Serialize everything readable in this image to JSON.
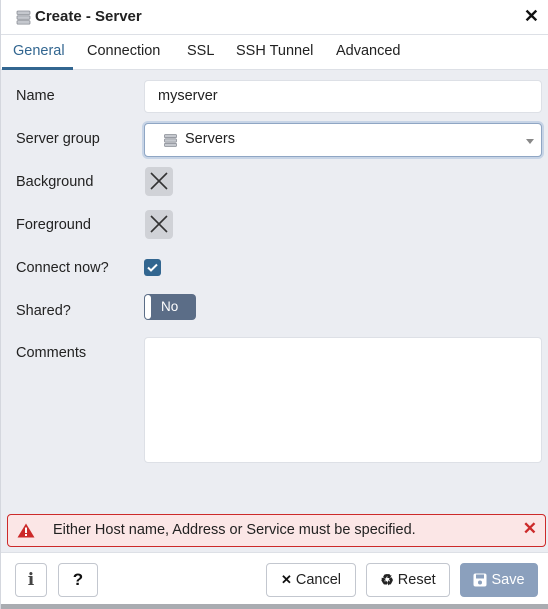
{
  "dialog": {
    "title": "Create - Server",
    "title_icon": "server-icon",
    "close_label": "✕"
  },
  "tabs": [
    {
      "label": "General",
      "active": true
    },
    {
      "label": "Connection",
      "active": false
    },
    {
      "label": "SSL",
      "active": false
    },
    {
      "label": "SSH Tunnel",
      "active": false
    },
    {
      "label": "Advanced",
      "active": false
    }
  ],
  "form": {
    "name": {
      "label": "Name",
      "value": "myserver"
    },
    "server_group": {
      "label": "Server group",
      "value": "Servers",
      "icon": "server-group-icon"
    },
    "background": {
      "label": "Background",
      "icon": "x-icon"
    },
    "foreground": {
      "label": "Foreground",
      "icon": "x-icon"
    },
    "connect_now": {
      "label": "Connect now?",
      "checked": true
    },
    "shared": {
      "label": "Shared?",
      "value": "No"
    },
    "comments": {
      "label": "Comments",
      "value": ""
    }
  },
  "alert": {
    "message": "Either Host name, Address or Service must be specified.",
    "icon": "warning-triangle-icon",
    "close_label": "✕"
  },
  "footer": {
    "info_label": "i",
    "help_label": "?",
    "cancel_label": "Cancel",
    "cancel_icon": "✕",
    "reset_label": "Reset",
    "reset_icon": "♻",
    "save_label": "Save"
  },
  "colors": {
    "accent": "#326690",
    "toggle_bg": "#5b6d87",
    "alert_border": "#cc2a2a",
    "alert_bg": "#fbe6e6",
    "save_disabled": "#8ba0bd"
  }
}
